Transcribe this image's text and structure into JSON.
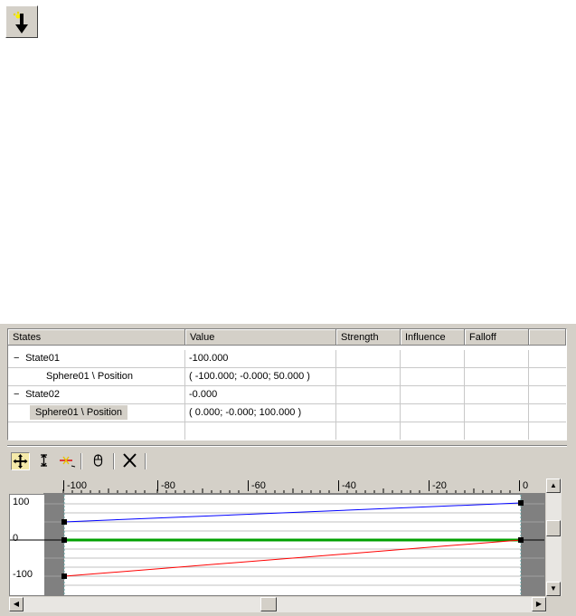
{
  "icon_button": {
    "icon": "set-key-arrow-icon"
  },
  "sheet": {
    "columns": [
      "States",
      "Value",
      "Strength",
      "Influence",
      "Falloff",
      ""
    ],
    "rows": [
      {
        "label": "State01",
        "toggle": "−",
        "value": "-100.000"
      },
      {
        "label": "Sphere01 \\ Position",
        "toggle": "",
        "value": "( -100.000; -0.000; 50.000 )"
      },
      {
        "label": "State02",
        "toggle": "−",
        "value": "-0.000"
      },
      {
        "label": "Sphere01 \\ Position",
        "toggle": "",
        "value": "( 0.000; -0.000; 100.000 )"
      }
    ]
  },
  "toolbar": {
    "items": [
      "move-keys-icon",
      "scale-keys-icon",
      "add-point-icon",
      "mouse-icon",
      "delete-icon"
    ]
  },
  "ruler": {
    "ticks": [
      "-100",
      "-80",
      "-60",
      "-40",
      "-20",
      "0"
    ]
  },
  "y_axis": {
    "labels": [
      "100",
      "0",
      "-100"
    ]
  },
  "colors": {
    "x_curve": "#ff0000",
    "y_curve": "#00a000",
    "z_curve": "#0000ff",
    "active_tool": "#f4e9a8"
  },
  "curves": {
    "x": {
      "from": -100,
      "to": 0
    },
    "y": {
      "from": 0,
      "to": 0
    },
    "z": {
      "from": 50,
      "to": 100
    }
  }
}
